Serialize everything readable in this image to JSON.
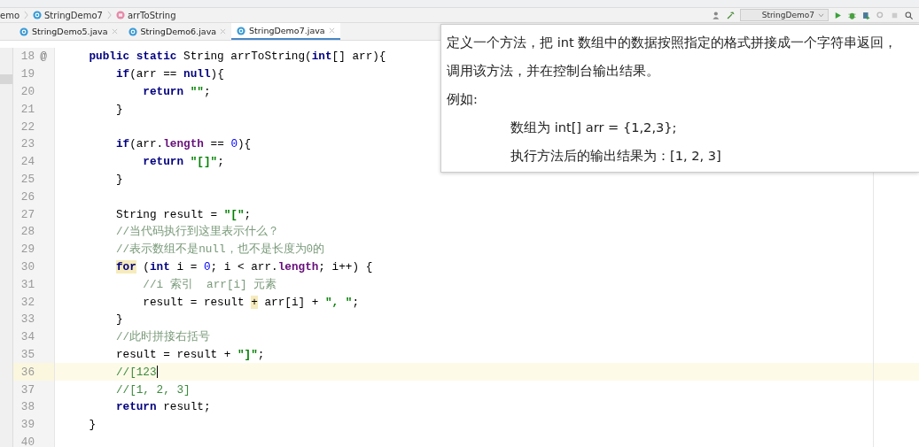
{
  "breadcrumbs": [
    {
      "label": "emo"
    },
    {
      "label": "StringDemo7"
    },
    {
      "label": "arrToString"
    }
  ],
  "run_config": {
    "label": "StringDemo7"
  },
  "tabs": [
    {
      "label": "StringDemo5.java",
      "selected": false
    },
    {
      "label": "StringDemo6.java",
      "selected": false
    },
    {
      "label": "StringDemo7.java",
      "selected": true
    }
  ],
  "lines": [
    {
      "number": "18",
      "mark": "@",
      "tokens": [
        {
          "t": "public static ",
          "kind": "kw"
        },
        {
          "t": "String arrToString(",
          "kind": "plain"
        },
        {
          "t": "int",
          "kind": "kw"
        },
        {
          "t": "[] arr){",
          "kind": "plain"
        }
      ],
      "children": [
        {
          "number": "19",
          "tokens": [
            {
              "t": "if",
              "kind": "kw"
            },
            {
              "t": "(arr == ",
              "kind": "plain"
            },
            {
              "t": "null",
              "kind": "kw"
            },
            {
              "t": "){",
              "kind": "plain"
            }
          ],
          "children": [
            {
              "number": "20",
              "tokens": [
                {
                  "t": "return ",
                  "kind": "kw"
                },
                {
                  "t": "\"\"",
                  "kind": "str"
                },
                {
                  "t": ";",
                  "kind": "plain"
                }
              ]
            }
          ]
        },
        {
          "number": "21",
          "tokens": [
            {
              "t": "}",
              "kind": "plain"
            }
          ]
        },
        {
          "number": "22"
        },
        {
          "number": "23",
          "tokens": [
            {
              "t": "if",
              "kind": "kw"
            },
            {
              "t": "(arr.",
              "kind": "plain"
            },
            {
              "t": "length",
              "kind": "field"
            },
            {
              "t": " == ",
              "kind": "plain"
            },
            {
              "t": "0",
              "kind": "num"
            },
            {
              "t": "){",
              "kind": "plain"
            }
          ],
          "children": [
            {
              "number": "24",
              "tokens": [
                {
                  "t": "return ",
                  "kind": "kw"
                },
                {
                  "t": "\"[]\"",
                  "kind": "str"
                },
                {
                  "t": ";",
                  "kind": "plain"
                }
              ]
            }
          ]
        },
        {
          "number": "25",
          "tokens": [
            {
              "t": "}",
              "kind": "plain"
            }
          ]
        },
        {
          "number": "26"
        },
        {
          "number": "27",
          "tokens": [
            {
              "t": "String result = ",
              "kind": "plain"
            },
            {
              "t": "\"[\"",
              "kind": "str"
            },
            {
              "t": ";",
              "kind": "plain"
            }
          ]
        },
        {
          "number": "28",
          "tokens": [
            {
              "t": "//当代码执行到这里表示什么？",
              "kind": "cmt"
            }
          ]
        },
        {
          "number": "29",
          "tokens": [
            {
              "t": "//表示数组不是null，也不是长度为0的",
              "kind": "cmt"
            }
          ]
        },
        {
          "number": "30",
          "tokens": [
            {
              "t": "for",
              "kind": "kw",
              "hl": true
            },
            {
              "t": " (",
              "kind": "plain"
            },
            {
              "t": "int",
              "kind": "kw"
            },
            {
              "t": " i = ",
              "kind": "plain"
            },
            {
              "t": "0",
              "kind": "num"
            },
            {
              "t": "; i < arr.",
              "kind": "plain"
            },
            {
              "t": "length",
              "kind": "field"
            },
            {
              "t": "; i++) {",
              "kind": "plain"
            }
          ],
          "children": [
            {
              "number": "31",
              "tokens": [
                {
                  "t": "//i 索引  arr[i] 元素",
                  "kind": "cmt"
                }
              ]
            },
            {
              "number": "32",
              "tokens": [
                {
                  "t": "result = result ",
                  "kind": "plain"
                },
                {
                  "t": "+",
                  "kind": "plain",
                  "hl": true
                },
                {
                  "t": " arr[i] + ",
                  "kind": "plain"
                },
                {
                  "t": "\", \"",
                  "kind": "str"
                },
                {
                  "t": ";",
                  "kind": "plain"
                }
              ]
            }
          ]
        },
        {
          "number": "33",
          "tokens": [
            {
              "t": "}",
              "kind": "plain"
            }
          ]
        },
        {
          "number": "34",
          "tokens": [
            {
              "t": "//此时拼接右括号",
              "kind": "cmt"
            }
          ]
        },
        {
          "number": "35",
          "tokens": [
            {
              "t": "result = result + ",
              "kind": "plain"
            },
            {
              "t": "\"]\"",
              "kind": "str"
            },
            {
              "t": ";",
              "kind": "plain"
            }
          ]
        },
        {
          "number": "36",
          "current": true,
          "tokens": [
            {
              "t": "//[123",
              "kind": "cmt2"
            }
          ]
        },
        {
          "number": "37",
          "tokens": [
            {
              "t": "//[1, 2, 3]",
              "kind": "cmt2"
            }
          ]
        },
        {
          "number": "38",
          "tokens": [
            {
              "t": "return ",
              "kind": "kw"
            },
            {
              "t": "result;",
              "kind": "plain"
            }
          ]
        }
      ]
    },
    {
      "number": "39",
      "tokens": [
        {
          "t": "}",
          "kind": "plain"
        }
      ]
    },
    {
      "number": "40"
    }
  ],
  "task_popup": {
    "paragraphs": [
      {
        "text": "定义一个方法，把 int 数组中的数据按照指定的格式拼接成一个字符串返回，"
      },
      {
        "text": "调用该方法，并在控制台输出结果。"
      },
      {
        "text": "例如:",
        "children": [
          {
            "text": "数组为 int[] arr = {1,2,3};"
          },
          {
            "text": "执行方法后的输出结果为：[1, 2, 3]"
          }
        ]
      }
    ]
  }
}
